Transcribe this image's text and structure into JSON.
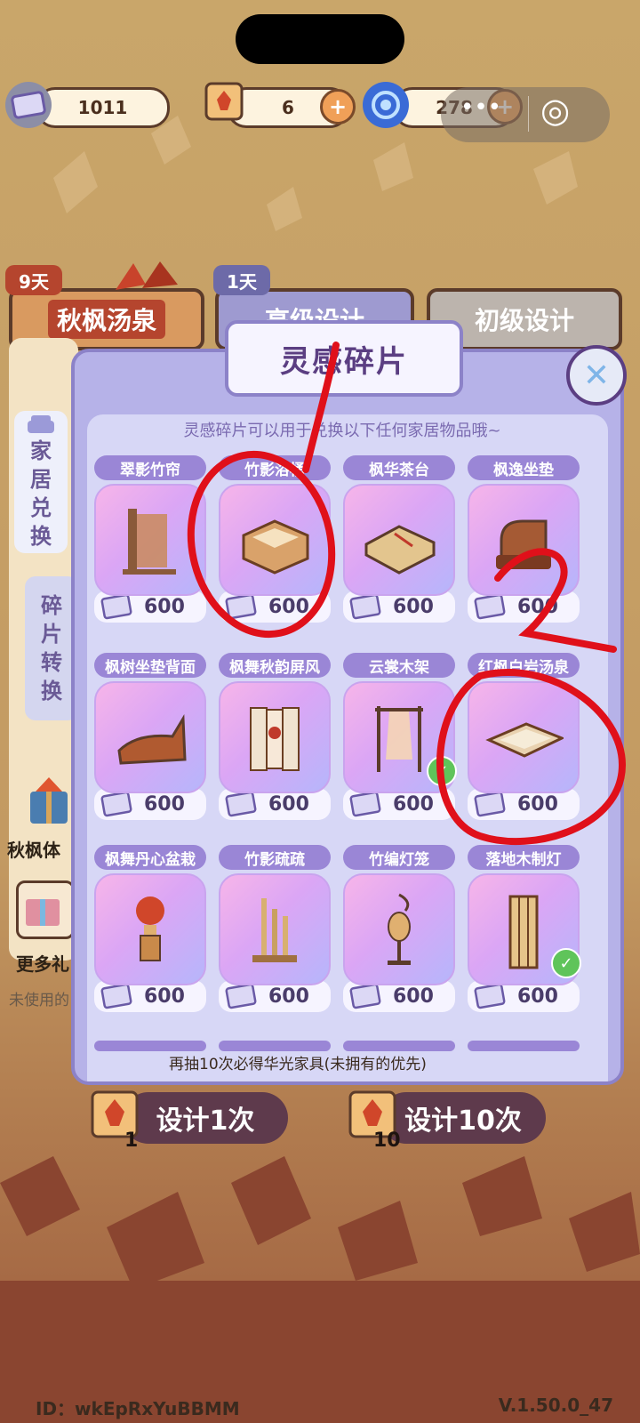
{
  "resources": [
    {
      "name": "fragment",
      "value": "1011",
      "icon": "fragment-icon"
    },
    {
      "name": "scroll",
      "value": "6",
      "icon": "maple-scroll-icon"
    },
    {
      "name": "swirl",
      "value": "278",
      "icon": "swirl-icon"
    }
  ],
  "capsule": {
    "more": "•••",
    "record": "◎"
  },
  "tabs": [
    {
      "label": "秋枫汤泉",
      "days": "9天"
    },
    {
      "label": "高级设计",
      "days": "1天"
    },
    {
      "label": "初级设计"
    }
  ],
  "side": {
    "home_exchange": [
      "家",
      "居",
      "兑",
      "换"
    ],
    "fragment_convert": [
      "碎",
      "片",
      "转",
      "换"
    ],
    "event_label": "秋枫体",
    "more_gifts": "更多礼",
    "unused": "未使用的"
  },
  "panel": {
    "title": "灵感碎片",
    "subtitle": "灵感碎片可以用于兑换以下任何家居物品哦~",
    "close": "✕"
  },
  "items": [
    {
      "name": "翠影竹帘",
      "price": "600",
      "owned": false
    },
    {
      "name": "竹影浴桶",
      "price": "600",
      "owned": false
    },
    {
      "name": "枫华茶台",
      "price": "600",
      "owned": false
    },
    {
      "name": "枫逸坐垫",
      "price": "600",
      "owned": false
    },
    {
      "name": "枫树坐垫背面",
      "price": "600",
      "owned": false
    },
    {
      "name": "枫舞秋韵屏风",
      "price": "600",
      "owned": false
    },
    {
      "name": "云裳木架",
      "price": "600",
      "owned": true
    },
    {
      "name": "红枫白岩汤泉",
      "price": "600",
      "owned": false
    },
    {
      "name": "枫舞丹心盆栽",
      "price": "600",
      "owned": false
    },
    {
      "name": "竹影疏疏",
      "price": "600",
      "owned": false
    },
    {
      "name": "竹编灯笼",
      "price": "600",
      "owned": false
    },
    {
      "name": "落地木制灯",
      "price": "600",
      "owned": true
    }
  ],
  "guarantee": "再抽10次必得华光家具(未拥有的优先)",
  "actions": {
    "design_one": "设计1次",
    "design_one_cost": "1",
    "design_ten": "设计10次",
    "design_ten_cost": "10"
  },
  "annotations": {
    "mark_one": "1",
    "mark_two": "2"
  },
  "footer": {
    "id": "ID：wkEpRxYuBBMM",
    "version": "V.1.50.0_47"
  }
}
